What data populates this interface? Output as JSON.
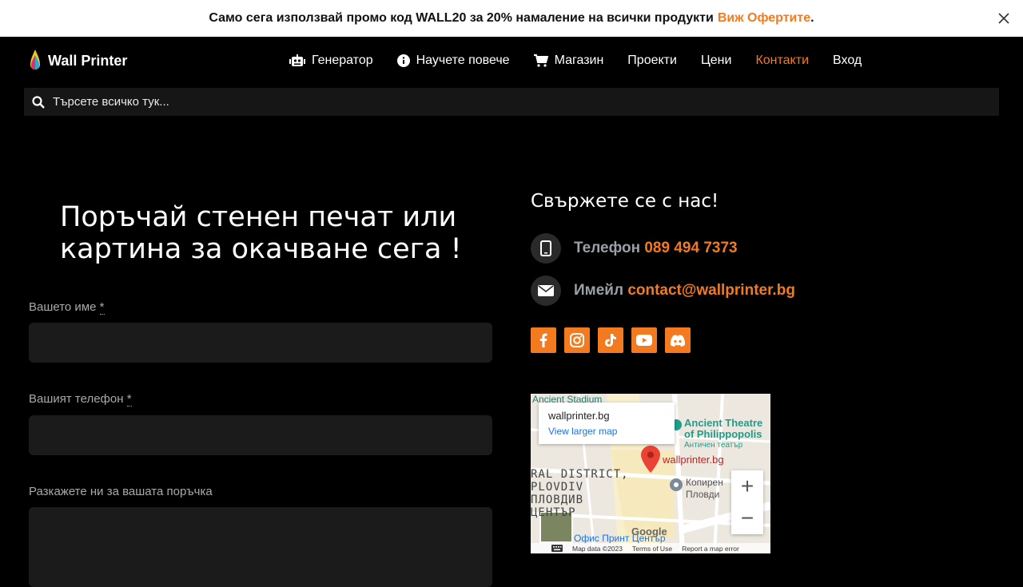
{
  "promo": {
    "text": "Само сега използвай промо код WALL20 за 20% намаление на всички продукти",
    "link": "Виж Офертите",
    "period": "."
  },
  "brand": {
    "name": "Wall Printer"
  },
  "nav": [
    {
      "label": "Генератор",
      "icon": "robot-icon"
    },
    {
      "label": "Научете повече",
      "icon": "info-icon"
    },
    {
      "label": "Магазин",
      "icon": "cart-icon"
    },
    {
      "label": "Проекти"
    },
    {
      "label": "Цени"
    },
    {
      "label": "Контакти",
      "active": true
    },
    {
      "label": "Вход"
    }
  ],
  "search": {
    "placeholder": "Търсете всичко тук..."
  },
  "form": {
    "title": "Поръчай стенен печат или картина за окачване сега !",
    "name_label": "Вашето име",
    "phone_label": "Вашият телефон",
    "order_label": "Разкажете ни за вашата поръчка",
    "required_mark": "*"
  },
  "contact": {
    "title": "Свържете се с нас!",
    "phone_label": "Телефон",
    "phone_value": "089 494 7373",
    "email_label": "Имейл",
    "email_value": "contact@wallprinter.bg"
  },
  "socials": [
    "facebook-icon",
    "instagram-icon",
    "tiktok-icon",
    "youtube-icon",
    "discord-icon"
  ],
  "map": {
    "place_name": "wallprinter.bg",
    "view_larger": "View larger map",
    "marker_label": "wallprinter.bg",
    "poi_1": "Ancient Theatre",
    "poi_1b": "of Philippopolis",
    "poi_1c": "Античен театър",
    "poi_top": "Ancient Stadium",
    "district_1": "RAL DISTRICT,",
    "district_2": "PLOVDIV",
    "district_3": "ПЛОВДИВ",
    "district_4": "ЦЕНТЪР",
    "poi_2": "Копирен",
    "poi_2b": "Пловди",
    "poi_3": "Офис Принт Център",
    "google": "Google",
    "footer_data": "Map data ©2023",
    "footer_terms": "Terms of Use",
    "footer_report": "Report a map error",
    "zoom_in": "+",
    "zoom_out": "−"
  },
  "colors": {
    "accent": "#f47a1f",
    "field_bg": "#1b1b1b",
    "search_bg": "#161616"
  }
}
